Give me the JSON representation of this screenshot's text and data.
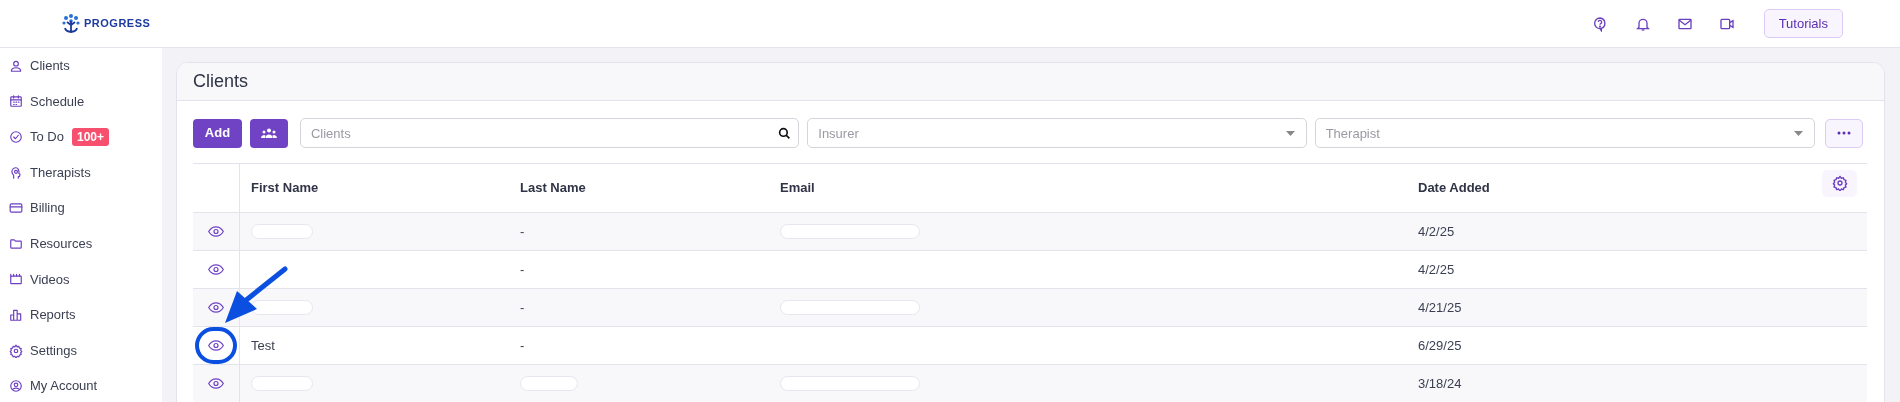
{
  "logo": {
    "text": "PROGRESS"
  },
  "header": {
    "tutorials_button": "Tutorials"
  },
  "sidebar": {
    "items": [
      {
        "label": "Clients"
      },
      {
        "label": "Schedule"
      },
      {
        "label": "To Do",
        "badge": "100+"
      },
      {
        "label": "Therapists"
      },
      {
        "label": "Billing"
      },
      {
        "label": "Resources"
      },
      {
        "label": "Videos"
      },
      {
        "label": "Reports"
      },
      {
        "label": "Settings"
      },
      {
        "label": "My Account"
      }
    ]
  },
  "page": {
    "title": "Clients"
  },
  "toolbar": {
    "add_button": "Add",
    "search": {
      "placeholder": "Clients"
    },
    "insurer": {
      "placeholder": "Insurer"
    },
    "therapist": {
      "placeholder": "Therapist"
    }
  },
  "table": {
    "columns": [
      "First Name",
      "Last Name",
      "Email",
      "Date Added"
    ],
    "rows": [
      {
        "highlighted": false,
        "cells": [
          {
            "kind": "redacted"
          },
          {
            "kind": "text",
            "text": "-"
          },
          {
            "kind": "redacted"
          },
          {
            "kind": "text",
            "text": "4/2/25"
          }
        ]
      },
      {
        "highlighted": false,
        "cells": [
          {
            "kind": "blank"
          },
          {
            "kind": "text",
            "text": "-"
          },
          {
            "kind": "blank"
          },
          {
            "kind": "text",
            "text": "4/2/25"
          }
        ]
      },
      {
        "highlighted": false,
        "cells": [
          {
            "kind": "redacted"
          },
          {
            "kind": "text",
            "text": "-"
          },
          {
            "kind": "redacted"
          },
          {
            "kind": "text",
            "text": "4/21/25"
          }
        ]
      },
      {
        "highlighted": true,
        "cells": [
          {
            "kind": "text",
            "text": "Test"
          },
          {
            "kind": "text",
            "text": "-"
          },
          {
            "kind": "blank"
          },
          {
            "kind": "text",
            "text": "6/29/25"
          }
        ]
      },
      {
        "highlighted": false,
        "cells": [
          {
            "kind": "redacted"
          },
          {
            "kind": "redacted"
          },
          {
            "kind": "redacted"
          },
          {
            "kind": "text",
            "text": "3/18/24"
          }
        ]
      }
    ]
  }
}
